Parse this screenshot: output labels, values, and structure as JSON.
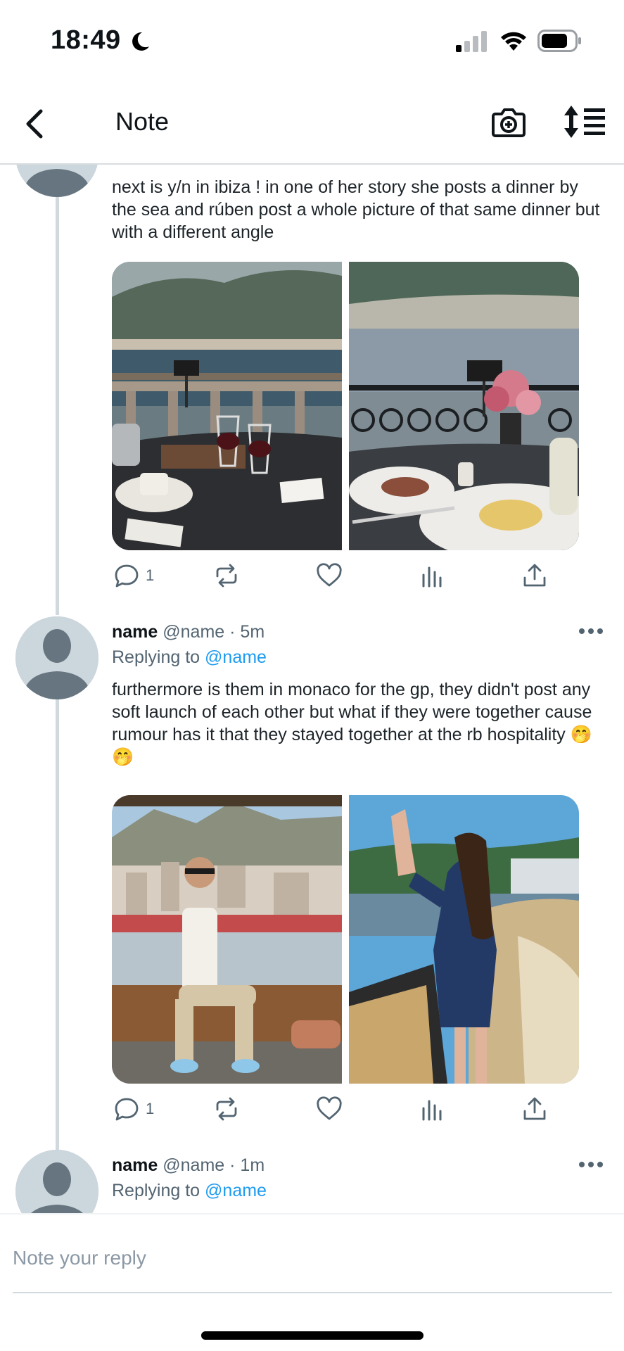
{
  "status_bar": {
    "time": "18:49",
    "icons": [
      "moon-icon",
      "cellular-signal-icon",
      "wifi-icon",
      "battery-icon"
    ]
  },
  "nav": {
    "title": "Note",
    "icons": [
      "back-chevron-icon",
      "camera-plus-icon",
      "sort-icon"
    ]
  },
  "colors": {
    "link": "#1d9bf0",
    "secondary_text": "#536471",
    "thread_line": "#cfd9de",
    "avatar_bg": "#ccd6dd"
  },
  "tweets": [
    {
      "text": "next is y/n in ibiza ! in one of her story she posts a dinner by the sea and rúben post a whole picture of that same dinner but with a different angle",
      "images": [
        "terrace-dinner-lake-view",
        "dinner-table-flowers-lake-view"
      ],
      "reply_count": "1"
    },
    {
      "name": "name",
      "handle": "@name",
      "time": "· 5m",
      "replying_label": "Replying to",
      "replying_handle": "@name",
      "text": "furthermore is them in monaco for the gp, they didn't post any soft launch of each other but what if they were together cause rumour has it that they stayed together at the rb hospitality 🤭🤭",
      "images": [
        "man-seated-monaco-harbour",
        "woman-on-yacht-waving"
      ],
      "reply_count": "1"
    },
    {
      "name": "name",
      "handle": "@name",
      "time": "· 1m",
      "replying_label": "Replying to",
      "replying_handle": "@name"
    }
  ],
  "reply_box": {
    "placeholder": "Note your reply"
  }
}
